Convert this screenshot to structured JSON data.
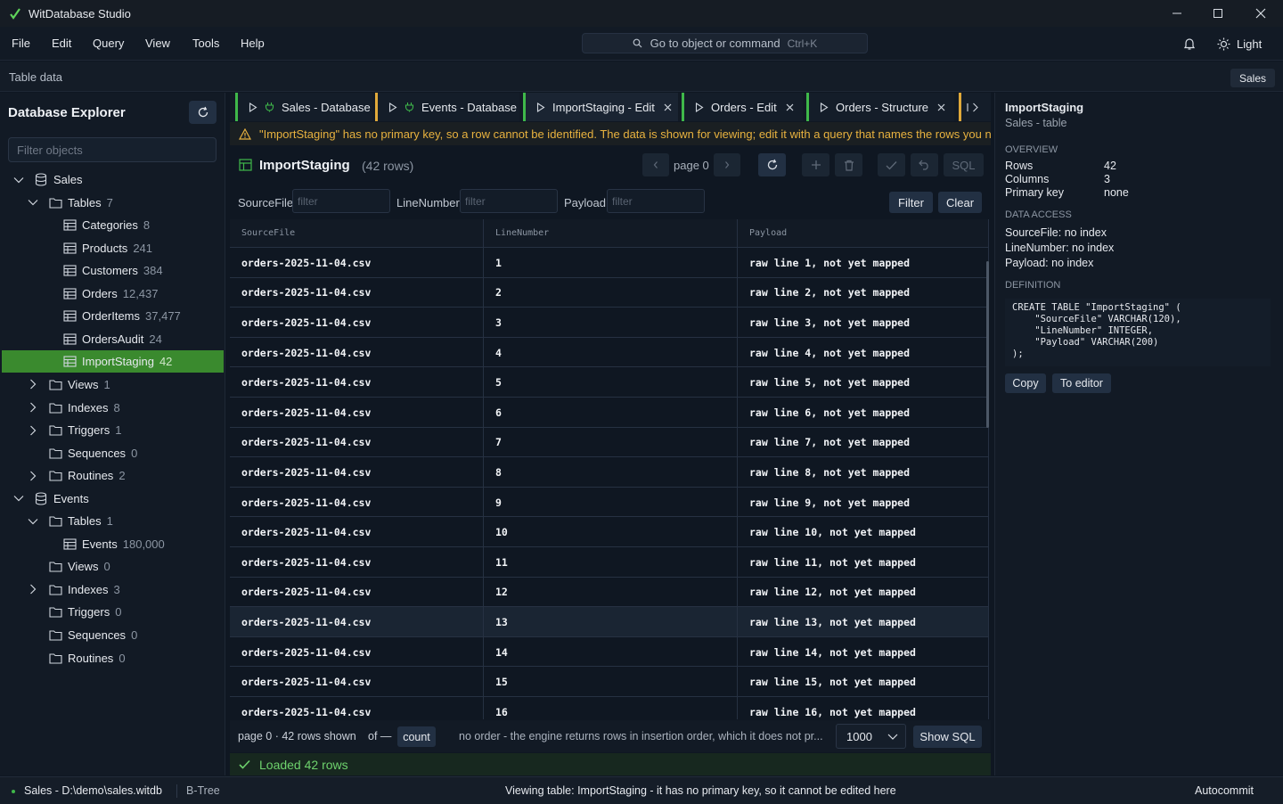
{
  "app": {
    "title": "WitDatabase Studio"
  },
  "menu": [
    "File",
    "Edit",
    "Query",
    "View",
    "Tools",
    "Help"
  ],
  "command_search": {
    "placeholder": "Go to object or command",
    "shortcut": "Ctrl+K"
  },
  "theme_button": "Light",
  "context": {
    "title": "Table data",
    "database_badge": "Sales"
  },
  "explorer": {
    "title": "Database Explorer",
    "filter_placeholder": "Filter objects",
    "tree": [
      {
        "label": "Sales",
        "count": "",
        "kind": "database",
        "expanded": true
      },
      {
        "label": "Tables",
        "count": "7",
        "kind": "folder",
        "expanded": true
      },
      {
        "label": "Categories",
        "count": "8",
        "kind": "table"
      },
      {
        "label": "Products",
        "count": "241",
        "kind": "table"
      },
      {
        "label": "Customers",
        "count": "384",
        "kind": "table"
      },
      {
        "label": "Orders",
        "count": "12,437",
        "kind": "table"
      },
      {
        "label": "OrderItems",
        "count": "37,477",
        "kind": "table"
      },
      {
        "label": "OrdersAudit",
        "count": "24",
        "kind": "table"
      },
      {
        "label": "ImportStaging",
        "count": "42",
        "kind": "table",
        "selected": true
      },
      {
        "label": "Views",
        "count": "1",
        "kind": "folder",
        "expanded": false
      },
      {
        "label": "Indexes",
        "count": "8",
        "kind": "folder",
        "expanded": false
      },
      {
        "label": "Triggers",
        "count": "1",
        "kind": "folder",
        "expanded": false
      },
      {
        "label": "Sequences",
        "count": "0",
        "kind": "folder"
      },
      {
        "label": "Routines",
        "count": "2",
        "kind": "folder",
        "expanded": false
      },
      {
        "label": "Events",
        "count": "",
        "kind": "database",
        "expanded": true
      },
      {
        "label": "Tables",
        "count": "1",
        "kind": "folder",
        "expanded": true
      },
      {
        "label": "Events",
        "count": "180,000",
        "kind": "table"
      },
      {
        "label": "Views",
        "count": "0",
        "kind": "folder"
      },
      {
        "label": "Indexes",
        "count": "3",
        "kind": "folder",
        "expanded": false
      },
      {
        "label": "Triggers",
        "count": "0",
        "kind": "folder"
      },
      {
        "label": "Sequences",
        "count": "0",
        "kind": "folder"
      },
      {
        "label": "Routines",
        "count": "0",
        "kind": "folder"
      }
    ]
  },
  "tabs": [
    {
      "label": "Sales - Database",
      "kind": "database",
      "color": "#3fb84a",
      "closable": false
    },
    {
      "label": "Events - Database",
      "kind": "database",
      "color": "#e0a93a",
      "closable": false
    },
    {
      "label": "ImportStaging - Edit",
      "kind": "edit",
      "color": "#3fb84a",
      "closable": true,
      "active": true
    },
    {
      "label": "Orders - Edit",
      "kind": "edit",
      "color": "#3fb84a",
      "closable": true
    },
    {
      "label": "Orders - Structure",
      "kind": "structure",
      "color": "#3fb84a",
      "closable": true
    }
  ],
  "warning": "\"ImportStaging\" has no primary key, so a row cannot be identified. The data is shown for viewing; edit it with a query that names the rows you n",
  "table": {
    "name": "ImportStaging",
    "rows_label": "(42 rows)",
    "page_label": "page 0",
    "sql_label": "SQL",
    "filter_button": "Filter",
    "clear_button": "Clear",
    "filter_placeholder": "filter",
    "columns": [
      "SourceFile",
      "LineNumber",
      "Payload"
    ],
    "rows": [
      [
        "orders-2025-11-04.csv",
        "1",
        "raw line 1, not yet mapped"
      ],
      [
        "orders-2025-11-04.csv",
        "2",
        "raw line 2, not yet mapped"
      ],
      [
        "orders-2025-11-04.csv",
        "3",
        "raw line 3, not yet mapped"
      ],
      [
        "orders-2025-11-04.csv",
        "4",
        "raw line 4, not yet mapped"
      ],
      [
        "orders-2025-11-04.csv",
        "5",
        "raw line 5, not yet mapped"
      ],
      [
        "orders-2025-11-04.csv",
        "6",
        "raw line 6, not yet mapped"
      ],
      [
        "orders-2025-11-04.csv",
        "7",
        "raw line 7, not yet mapped"
      ],
      [
        "orders-2025-11-04.csv",
        "8",
        "raw line 8, not yet mapped"
      ],
      [
        "orders-2025-11-04.csv",
        "9",
        "raw line 9, not yet mapped"
      ],
      [
        "orders-2025-11-04.csv",
        "10",
        "raw line 10, not yet mapped"
      ],
      [
        "orders-2025-11-04.csv",
        "11",
        "raw line 11, not yet mapped"
      ],
      [
        "orders-2025-11-04.csv",
        "12",
        "raw line 12, not yet mapped"
      ],
      [
        "orders-2025-11-04.csv",
        "13",
        "raw line 13, not yet mapped"
      ],
      [
        "orders-2025-11-04.csv",
        "14",
        "raw line 14, not yet mapped"
      ],
      [
        "orders-2025-11-04.csv",
        "15",
        "raw line 15, not yet mapped"
      ],
      [
        "orders-2025-11-04.csv",
        "16",
        "raw line 16, not yet mapped"
      ]
    ],
    "highlighted_row": 13
  },
  "grid_footer": {
    "page_info": "page 0 · 42 rows shown",
    "of_label": "of —",
    "count_button": "count",
    "order_note": "no order - the engine returns rows in insertion order, which it does not pr...",
    "limit": "1000",
    "show_sql": "Show SQL"
  },
  "loaded_message": "Loaded 42 rows",
  "details": {
    "title": "ImportStaging",
    "subtitle": "Sales - table",
    "overview_heading": "OVERVIEW",
    "overview": [
      {
        "label": "Rows",
        "value": "42"
      },
      {
        "label": "Columns",
        "value": "3"
      },
      {
        "label": "Primary key",
        "value": "none"
      }
    ],
    "access_heading": "DATA ACCESS",
    "access": [
      "SourceFile: no index",
      "LineNumber: no index",
      "Payload: no index"
    ],
    "definition_heading": "DEFINITION",
    "definition": "CREATE TABLE \"ImportStaging\" (\n    \"SourceFile\" VARCHAR(120),\n    \"LineNumber\" INTEGER,\n    \"Payload\" VARCHAR(200)\n);",
    "copy_button": "Copy",
    "editor_button": "To editor"
  },
  "status": {
    "connection": "Sales - D:\\demo\\sales.witdb",
    "engine": "B-Tree",
    "message": "Viewing table: ImportStaging - it has no primary key, so it cannot be edited here",
    "mode": "Autocommit"
  },
  "colors": {
    "accent_green": "#3fb84a",
    "accent_yellow": "#e0a93a",
    "warning_text": "#e8b23f",
    "success_text": "#6ed26d"
  }
}
